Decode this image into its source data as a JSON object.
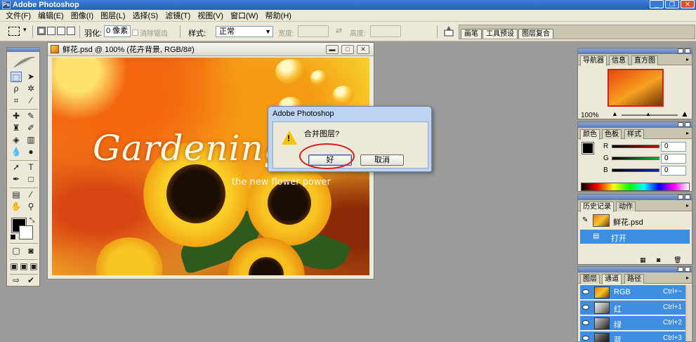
{
  "app": {
    "title": "Adobe Photoshop"
  },
  "menu": [
    "文件(F)",
    "编辑(E)",
    "图像(I)",
    "图层(L)",
    "选择(S)",
    "滤镜(T)",
    "视图(V)",
    "窗口(W)",
    "帮助(H)"
  ],
  "options": {
    "feather_label": "羽化:",
    "feather_value": "0 像素",
    "antialias_label": "消除锯齿",
    "style_label": "样式:",
    "style_value": "正常",
    "width_label": "宽度:",
    "height_label": "高度:"
  },
  "palette_well": {
    "tabs": [
      "画笔",
      "工具预设",
      "图层复合"
    ]
  },
  "document": {
    "title": "鲜花.psd @ 100% (花卉背景, RGB/8#)",
    "image_headline": "Gardening C",
    "image_tagline": "the new flower power"
  },
  "dialog": {
    "title": "Adobe Photoshop",
    "message": "合并图层?",
    "ok_label": "好",
    "cancel_label": "取消"
  },
  "navigator": {
    "tabs": [
      "导航器",
      "信息",
      "直方图"
    ],
    "zoom": "100%"
  },
  "color_panel": {
    "tabs": [
      "颜色",
      "色板",
      "样式"
    ],
    "channels": [
      {
        "name": "R",
        "value": "0",
        "color": "#cc1111"
      },
      {
        "name": "G",
        "value": "0",
        "color": "#11aa22"
      },
      {
        "name": "B",
        "value": "0",
        "color": "#1122bb"
      }
    ]
  },
  "history_panel": {
    "tabs": [
      "历史记录",
      "动作"
    ],
    "snapshot_label": "鲜花.psd",
    "items": [
      "打开"
    ]
  },
  "layers_panel": {
    "tabs": [
      "图层",
      "通道",
      "路径"
    ],
    "channels": [
      {
        "name": "RGB",
        "shortcut": "Ctrl+~"
      },
      {
        "name": "红",
        "shortcut": "Ctrl+1"
      },
      {
        "name": "绿",
        "shortcut": "Ctrl+2"
      },
      {
        "name": "蓝",
        "shortcut": "Ctrl+3"
      }
    ]
  },
  "colors": {
    "selection_blue": "#3d8ee0",
    "highlight_ring": "#d71d1d",
    "titlebar": "#1e5fbf"
  }
}
